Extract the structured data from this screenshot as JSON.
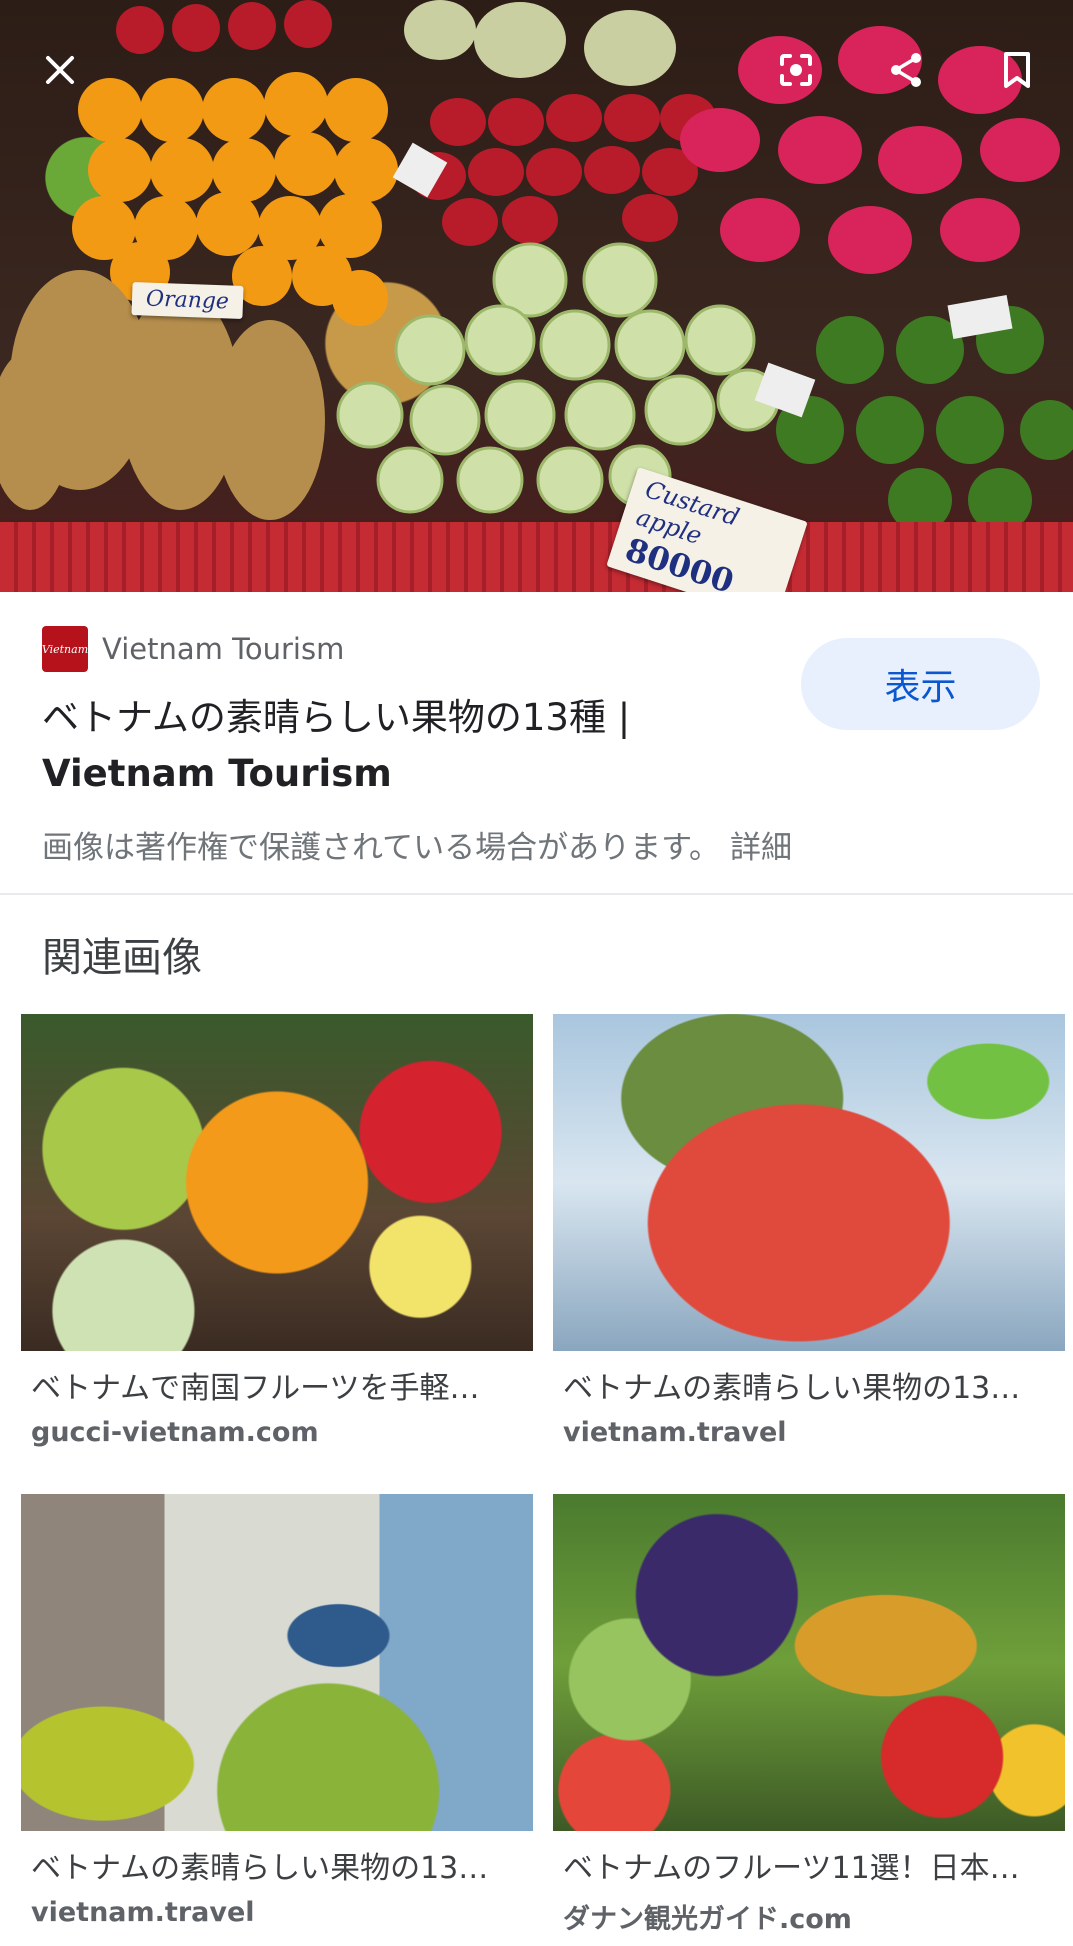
{
  "hero": {
    "tag_orange": "Orange",
    "tag_custard": "Custard apple",
    "tag_custard_price": "80000"
  },
  "icons": {
    "close": "close-icon",
    "lens": "lens-icon",
    "share": "share-icon",
    "save": "bookmark-icon"
  },
  "source": {
    "favicon_text": "Vietnam",
    "name": "Vietnam Tourism"
  },
  "result": {
    "title_line1": "ベトナムの素晴らしい果物の13種 |",
    "title_line2": "Vietnam Tourism",
    "view_button": "表示",
    "copyright": "画像は著作権で保護されている場合があります。",
    "details": "詳細"
  },
  "related": {
    "heading": "関連画像",
    "items": [
      {
        "caption": "ベトナムで南国フルーツを手軽…",
        "site": "gucci-vietnam.com"
      },
      {
        "caption": "ベトナムの素晴らしい果物の13…",
        "site": "vietnam.travel"
      },
      {
        "caption": "ベトナムの素晴らしい果物の13…",
        "site": "vietnam.travel"
      },
      {
        "caption": "ベトナムのフルーツ11選！日本…",
        "site": "ダナン観光ガイド.com"
      }
    ]
  },
  "colors": {
    "accent": "#0b57d0",
    "button_bg": "#e8f0fe",
    "favicon_bg": "#b5121b"
  }
}
